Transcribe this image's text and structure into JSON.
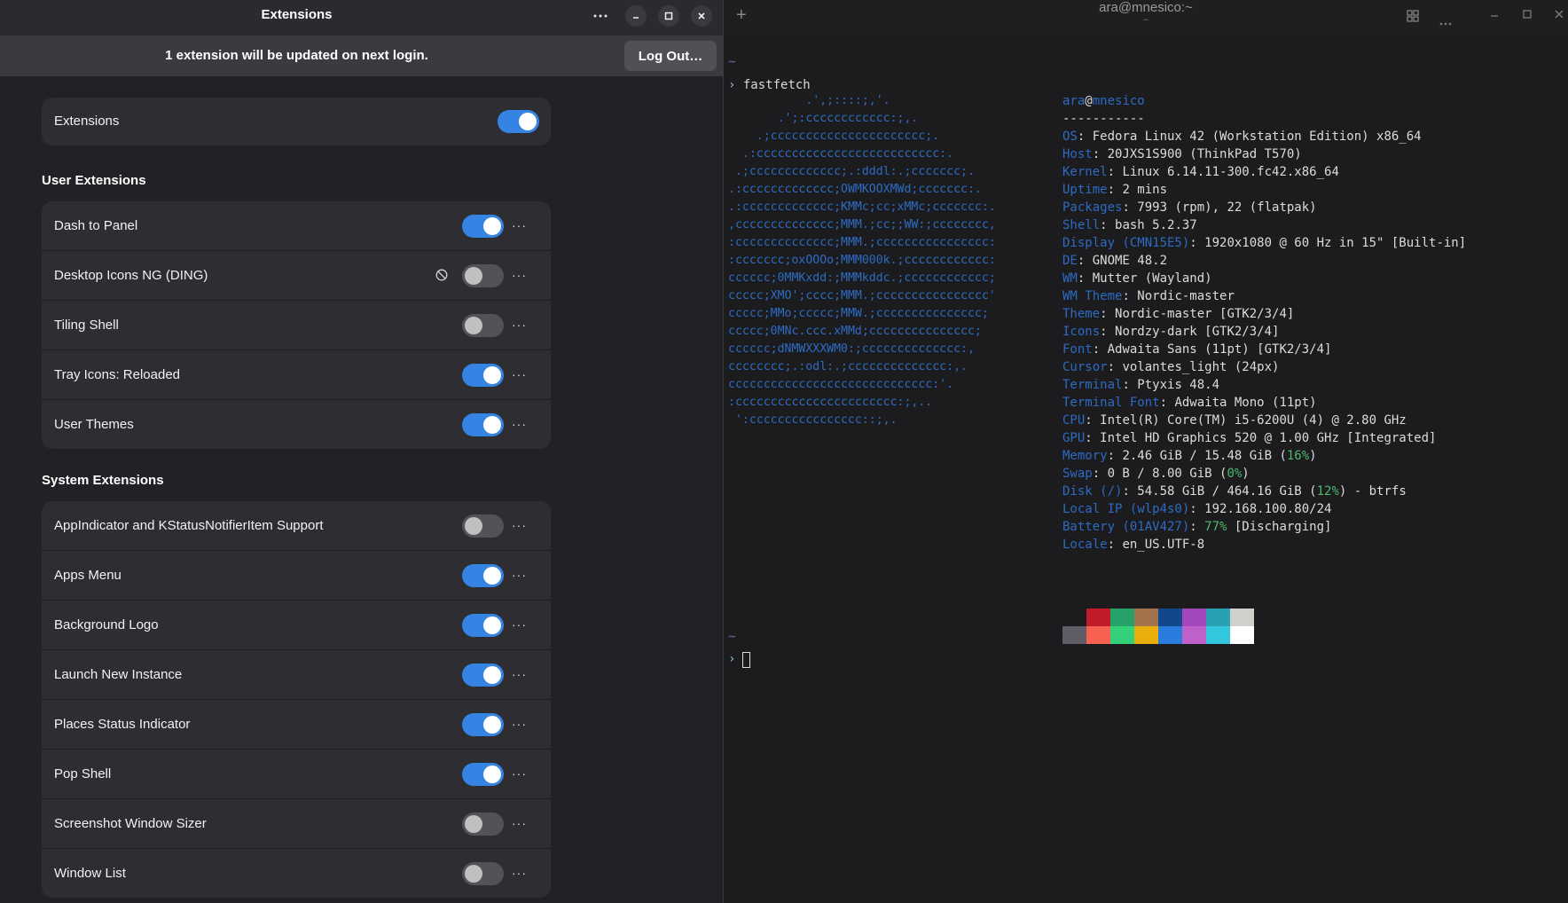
{
  "extensions_window": {
    "title": "Extensions",
    "titlebar_icons": [
      "menu-dots-icon",
      "minimize-icon",
      "maximize-icon",
      "close-icon"
    ],
    "banner": {
      "text": "1 extension will be updated on next login.",
      "button": "Log Out…"
    },
    "master": {
      "label": "Extensions",
      "enabled": true
    },
    "user_section_title": "User Extensions",
    "user_extensions": [
      {
        "name": "Dash to Panel",
        "enabled": true,
        "blocked": false
      },
      {
        "name": "Desktop Icons NG (DING)",
        "enabled": false,
        "blocked": true
      },
      {
        "name": "Tiling Shell",
        "enabled": false,
        "blocked": false
      },
      {
        "name": "Tray Icons: Reloaded",
        "enabled": true,
        "blocked": false
      },
      {
        "name": "User Themes",
        "enabled": true,
        "blocked": false
      }
    ],
    "system_section_title": "System Extensions",
    "system_extensions": [
      {
        "name": "AppIndicator and KStatusNotifierItem Support",
        "enabled": false
      },
      {
        "name": "Apps Menu",
        "enabled": true
      },
      {
        "name": "Background Logo",
        "enabled": true
      },
      {
        "name": "Launch New Instance",
        "enabled": true
      },
      {
        "name": "Places Status Indicator",
        "enabled": true
      },
      {
        "name": "Pop Shell",
        "enabled": true
      },
      {
        "name": "Screenshot Window Sizer",
        "enabled": false
      },
      {
        "name": "Window List",
        "enabled": false
      }
    ],
    "row_menu_glyph": "···"
  },
  "terminal": {
    "title": "ara@mnesico:~",
    "subtitle": "~",
    "titlebar_icons": [
      "add-tab-icon",
      "tab-overview-icon",
      "menu-dots-icon",
      "minimize-icon",
      "maximize-icon",
      "close-icon"
    ],
    "cwd": "~",
    "prompt_symbol": "›",
    "command": "fastfetch",
    "logo_lines": [
      "           .',;::::;,'.",
      "       .';:cccccccccccc:;,.",
      "    .;cccccccccccccccccccccc;.",
      "  .:cccccccccccccccccccccccccc:.",
      " .;ccccccccccccc;.:dddl:.;ccccccc;.",
      ".:ccccccccccccc;OWMKOOXMWd;ccccccc:.",
      ".:ccccccccccccc;KMMc;cc;xMMc;ccccccc:.",
      ",cccccccccccccc;MMM.;cc;;WW:;cccccccc,",
      ":cccccccccccccc;MMM.;cccccccccccccccc:",
      ":ccccccc;oxOOOo;MMM000k.;cccccccccccc:",
      "cccccc;0MMKxdd:;MMMkddc.;cccccccccccc;",
      "ccccc;XMO';cccc;MMM.;cccccccccccccccc'",
      "ccccc;MMo;ccccc;MMW.;ccccccccccccccc;",
      "ccccc;0MNc.ccc.xMMd;ccccccccccccccc;",
      "cccccc;dNMWXXXWM0:;cccccccccccccc:,",
      "cccccccc;.:odl:.;cccccccccccccc:,.",
      "ccccccccccccccccccccccccccccc:'.",
      ":ccccccccccccccccccccccc:;,..",
      " ':cccccccccccccccc::;,."
    ],
    "user_host": {
      "user": "ara",
      "at": "@",
      "host": "mnesico"
    },
    "separator": "-----------",
    "info": [
      {
        "key": "OS",
        "value": "Fedora Linux 42 (Workstation Edition) x86_64"
      },
      {
        "key": "Host",
        "value": "20JXS1S900 (ThinkPad T570)"
      },
      {
        "key": "Kernel",
        "value": "Linux 6.14.11-300.fc42.x86_64"
      },
      {
        "key": "Uptime",
        "value": "2 mins"
      },
      {
        "key": "Packages",
        "value": "7993 (rpm), 22 (flatpak)"
      },
      {
        "key": "Shell",
        "value": "bash 5.2.37"
      },
      {
        "key": "Display (CMN15E5)",
        "value": "1920x1080 @ 60 Hz in 15\" [Built-in]"
      },
      {
        "key": "DE",
        "value": "GNOME 48.2"
      },
      {
        "key": "WM",
        "value": "Mutter (Wayland)"
      },
      {
        "key": "WM Theme",
        "value": "Nordic-master"
      },
      {
        "key": "Theme",
        "value": "Nordic-master [GTK2/3/4]"
      },
      {
        "key": "Icons",
        "value": "Nordzy-dark [GTK2/3/4]"
      },
      {
        "key": "Font",
        "value": "Adwaita Sans (11pt) [GTK2/3/4]"
      },
      {
        "key": "Cursor",
        "value": "volantes_light (24px)"
      },
      {
        "key": "Terminal",
        "value": "Ptyxis 48.4"
      },
      {
        "key": "Terminal Font",
        "value": "Adwaita Mono (11pt)"
      },
      {
        "key": "CPU",
        "value": "Intel(R) Core(TM) i5-6200U (4) @ 2.80 GHz"
      },
      {
        "key": "GPU",
        "value": "Intel HD Graphics 520 @ 1.00 GHz [Integrated]"
      },
      {
        "key": "Memory",
        "value": "2.46 GiB / 15.48 GiB (",
        "highlight": "16%",
        "tail": ")"
      },
      {
        "key": "Swap",
        "value": "0 B / 8.00 GiB (",
        "highlight": "0%",
        "tail": ")"
      },
      {
        "key": "Disk (/)",
        "value": "54.58 GiB / 464.16 GiB (",
        "highlight": "12%",
        "tail": ") - btrfs"
      },
      {
        "key": "Local IP (wlp4s0)",
        "value": "192.168.100.80/24"
      },
      {
        "key": "Battery (01AV427)",
        "value": "",
        "highlight": "77%",
        "tail": " [Discharging]"
      },
      {
        "key": "Locale",
        "value": "en_US.UTF-8"
      }
    ],
    "palette_top": [
      "#1c1c1e",
      "#c01c28",
      "#26a269",
      "#a2734c",
      "#12488b",
      "#a347ba",
      "#2aa1b3",
      "#d0cfcc"
    ],
    "palette_bottom": [
      "#5e5c64",
      "#f66151",
      "#33d17a",
      "#e9ad0c",
      "#2a7bde",
      "#c061cb",
      "#33c7de",
      "#ffffff"
    ],
    "accent_colors": {
      "key": "#2d6bc4",
      "toggle_on": "#3584e4",
      "percent": "#4cb96e"
    }
  }
}
